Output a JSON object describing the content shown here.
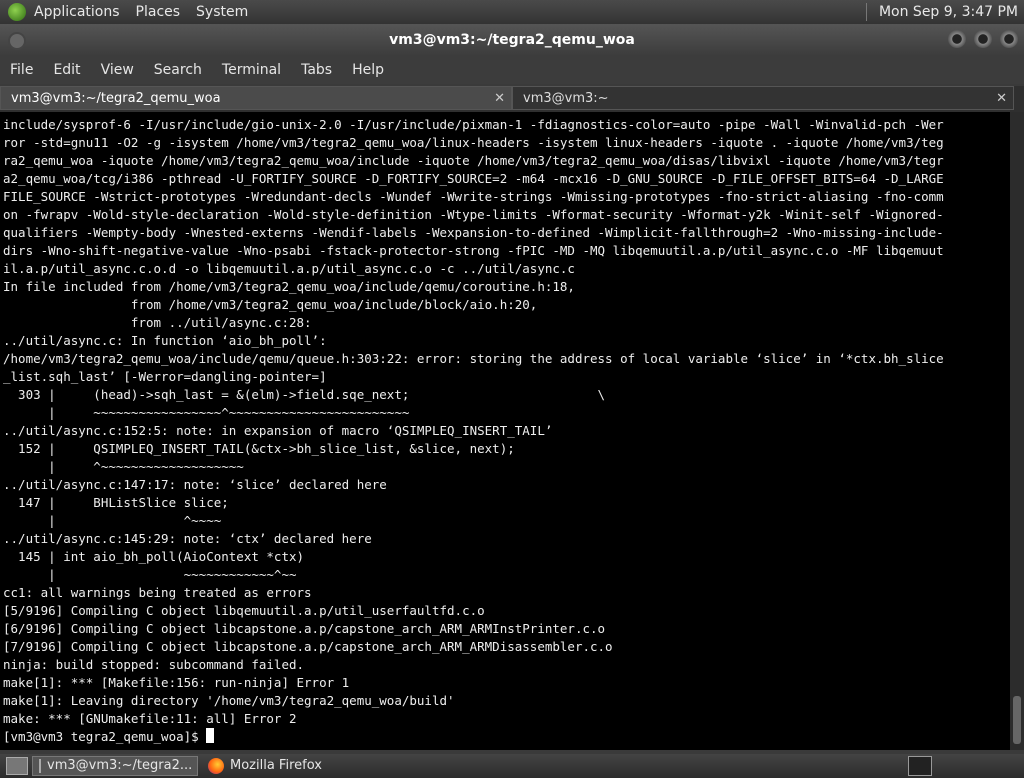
{
  "top_panel": {
    "menus": [
      "Applications",
      "Places",
      "System"
    ],
    "clock": "Mon Sep  9,  3:47 PM"
  },
  "window": {
    "title": "vm3@vm3:~/tegra2_qemu_woa"
  },
  "menubar": [
    "File",
    "Edit",
    "View",
    "Search",
    "Terminal",
    "Tabs",
    "Help"
  ],
  "tabs": [
    {
      "label": "vm3@vm3:~/tegra2_qemu_woa",
      "close": "✕"
    },
    {
      "label": "vm3@vm3:~",
      "close": "✕"
    }
  ],
  "terminal": {
    "lines": [
      "include/sysprof-6 -I/usr/include/gio-unix-2.0 -I/usr/include/pixman-1 -fdiagnostics-color=auto -pipe -Wall -Winvalid-pch -Wer",
      "ror -std=gnu11 -O2 -g -isystem /home/vm3/tegra2_qemu_woa/linux-headers -isystem linux-headers -iquote . -iquote /home/vm3/teg",
      "ra2_qemu_woa -iquote /home/vm3/tegra2_qemu_woa/include -iquote /home/vm3/tegra2_qemu_woa/disas/libvixl -iquote /home/vm3/tegr",
      "a2_qemu_woa/tcg/i386 -pthread -U_FORTIFY_SOURCE -D_FORTIFY_SOURCE=2 -m64 -mcx16 -D_GNU_SOURCE -D_FILE_OFFSET_BITS=64 -D_LARGE",
      "FILE_SOURCE -Wstrict-prototypes -Wredundant-decls -Wundef -Wwrite-strings -Wmissing-prototypes -fno-strict-aliasing -fno-comm",
      "on -fwrapv -Wold-style-declaration -Wold-style-definition -Wtype-limits -Wformat-security -Wformat-y2k -Winit-self -Wignored-",
      "qualifiers -Wempty-body -Wnested-externs -Wendif-labels -Wexpansion-to-defined -Wimplicit-fallthrough=2 -Wno-missing-include-",
      "dirs -Wno-shift-negative-value -Wno-psabi -fstack-protector-strong -fPIC -MD -MQ libqemuutil.a.p/util_async.c.o -MF libqemuut",
      "il.a.p/util_async.c.o.d -o libqemuutil.a.p/util_async.c.o -c ../util/async.c",
      "In file included from /home/vm3/tegra2_qemu_woa/include/qemu/coroutine.h:18,",
      "                 from /home/vm3/tegra2_qemu_woa/include/block/aio.h:20,",
      "                 from ../util/async.c:28:",
      "../util/async.c: In function ‘aio_bh_poll’:",
      "/home/vm3/tegra2_qemu_woa/include/qemu/queue.h:303:22: error: storing the address of local variable ‘slice’ in ‘*ctx.bh_slice",
      "_list.sqh_last’ [-Werror=dangling-pointer=]",
      "  303 |     (head)->sqh_last = &(elm)->field.sqe_next;                         \\",
      "      |     ~~~~~~~~~~~~~~~~~^~~~~~~~~~~~~~~~~~~~~~~~~",
      "../util/async.c:152:5: note: in expansion of macro ‘QSIMPLEQ_INSERT_TAIL’",
      "  152 |     QSIMPLEQ_INSERT_TAIL(&ctx->bh_slice_list, &slice, next);",
      "      |     ^~~~~~~~~~~~~~~~~~~~",
      "../util/async.c:147:17: note: ‘slice’ declared here",
      "  147 |     BHListSlice slice;",
      "      |                 ^~~~~",
      "../util/async.c:145:29: note: ‘ctx’ declared here",
      "  145 | int aio_bh_poll(AioContext *ctx)",
      "      |                 ~~~~~~~~~~~~^~~",
      "cc1: all warnings being treated as errors",
      "[5/9196] Compiling C object libqemuutil.a.p/util_userfaultfd.c.o",
      "[6/9196] Compiling C object libcapstone.a.p/capstone_arch_ARM_ARMInstPrinter.c.o",
      "[7/9196] Compiling C object libcapstone.a.p/capstone_arch_ARM_ARMDisassembler.c.o",
      "ninja: build stopped: subcommand failed.",
      "make[1]: *** [Makefile:156: run-ninja] Error 1",
      "make[1]: Leaving directory '/home/vm3/tegra2_qemu_woa/build'",
      "make: *** [GNUmakefile:11: all] Error 2"
    ],
    "prompt": "[vm3@vm3 tegra2_qemu_woa]$ "
  },
  "taskbar": {
    "tasks": [
      {
        "label": "vm3@vm3:~/tegra2...",
        "icon": "terminal-icon"
      },
      {
        "label": "Mozilla Firefox",
        "icon": "firefox-icon"
      }
    ]
  }
}
